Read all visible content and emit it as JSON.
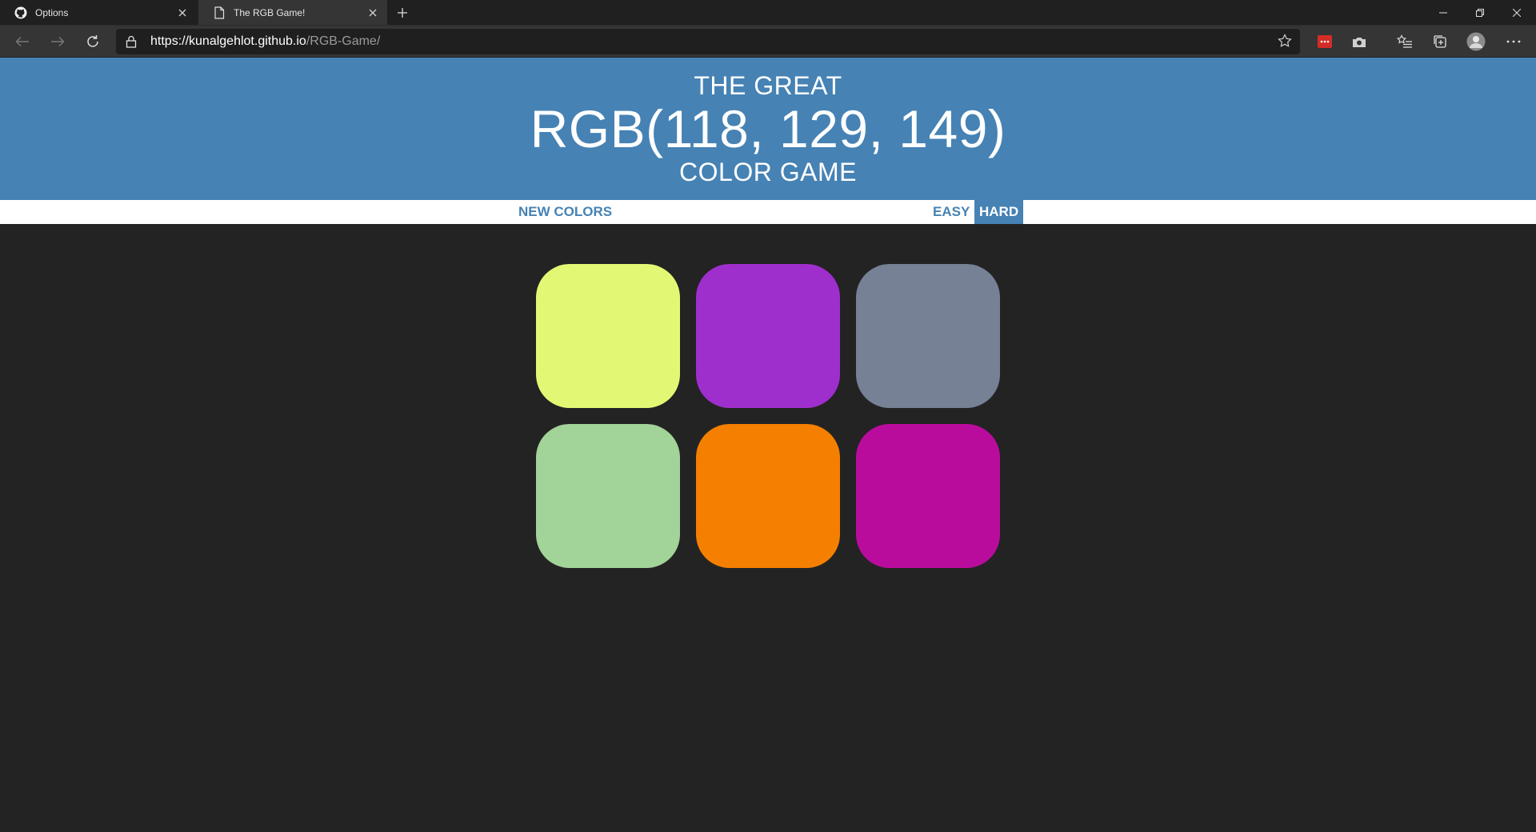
{
  "browser": {
    "tabs": [
      {
        "title": "Options",
        "icon": "github-icon",
        "active": false
      },
      {
        "title": "The RGB Game!",
        "icon": "page-icon",
        "active": true
      }
    ],
    "url_host": "https://kunalgehlot.github.io",
    "url_path": "/RGB-Game/"
  },
  "header": {
    "line1": "THE GREAT",
    "rgb": "RGB(118, 129, 149)",
    "line3": "COLOR GAME",
    "color": "#4682b4"
  },
  "stripe": {
    "new_colors": "NEW COLORS",
    "message": "",
    "easy": "EASY",
    "hard": "HARD",
    "selected_mode": "HARD"
  },
  "squares": [
    {
      "color": "#e2f874"
    },
    {
      "color": "#9e2fcd"
    },
    {
      "color": "#768195"
    },
    {
      "color": "#a2d398"
    },
    {
      "color": "#f47f00"
    },
    {
      "color": "#ba0c9c"
    }
  ],
  "background": "#232323"
}
